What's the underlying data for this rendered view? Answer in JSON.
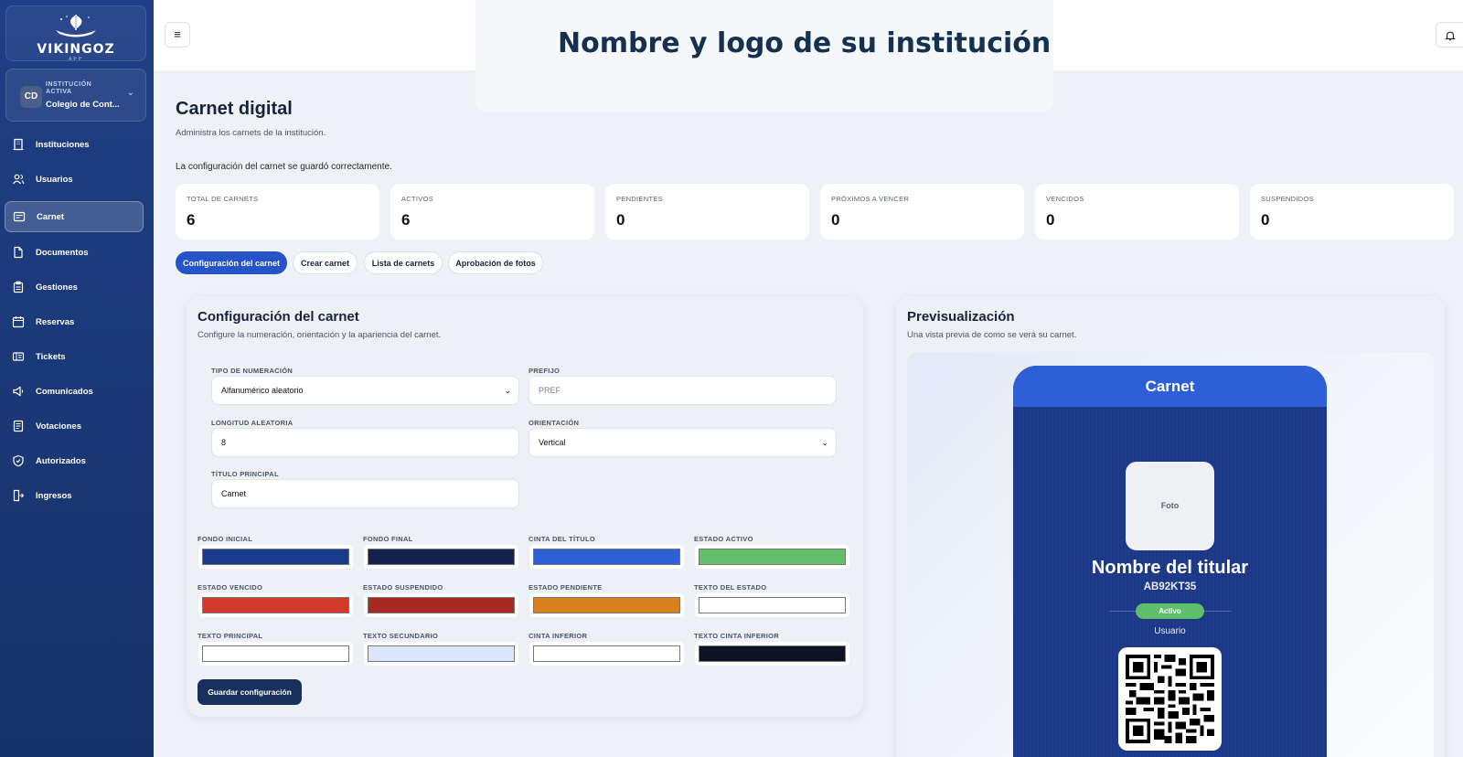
{
  "brand": {
    "name": "VIKINGOZ",
    "sub": "APP"
  },
  "institution": {
    "initials": "CD",
    "label": "INSTITUCIÓN ACTIVA",
    "name": "Colegio de Cont..."
  },
  "nav": [
    {
      "label": "Instituciones",
      "icon": "building-icon"
    },
    {
      "label": "Usuarios",
      "icon": "users-icon"
    },
    {
      "label": "Carnet",
      "icon": "id-card-icon",
      "active": true
    },
    {
      "label": "Documentos",
      "icon": "document-icon"
    },
    {
      "label": "Gestiones",
      "icon": "clipboard-icon"
    },
    {
      "label": "Reservas",
      "icon": "calendar-icon"
    },
    {
      "label": "Tickets",
      "icon": "ticket-icon"
    },
    {
      "label": "Comunicados",
      "icon": "megaphone-icon"
    },
    {
      "label": "Votaciones",
      "icon": "ballot-icon"
    },
    {
      "label": "Autorizados",
      "icon": "shield-icon"
    },
    {
      "label": "Ingresos",
      "icon": "login-icon"
    }
  ],
  "header": {
    "banner": "Nombre y logo de su institución"
  },
  "page": {
    "title": "Carnet digital",
    "subtitle": "Administra los carnets de la institución.",
    "notice": "La configuración del carnet se guardó correctamente."
  },
  "stats": [
    {
      "label": "TOTAL DE CARNETS",
      "value": "6"
    },
    {
      "label": "ACTIVOS",
      "value": "6"
    },
    {
      "label": "PENDIENTES",
      "value": "0"
    },
    {
      "label": "PRÓXIMOS A VENCER",
      "value": "0"
    },
    {
      "label": "VENCIDOS",
      "value": "0"
    },
    {
      "label": "SUSPENDIDOS",
      "value": "0"
    }
  ],
  "tabs": [
    {
      "label": "Configuración del carnet",
      "active": true
    },
    {
      "label": "Crear carnet"
    },
    {
      "label": "Lista de carnets"
    },
    {
      "label": "Aprobación de fotos"
    }
  ],
  "config": {
    "title": "Configuración del carnet",
    "subtitle": "Configure la numeración, orientación y la apariencia del carnet.",
    "numbering_label": "TIPO DE NUMERACIÓN",
    "numbering_value": "Alfanumérico aleatorio",
    "prefix_label": "PREFIJO",
    "prefix_placeholder": "PREF",
    "length_label": "LONGITUD ALEATORIA",
    "length_value": "8",
    "orientation_label": "ORIENTACIÓN",
    "orientation_value": "Vertical",
    "main_title_label": "TÍTULO PRINCIPAL",
    "main_title_value": "Carnet",
    "colors": [
      {
        "label": "FONDO INICIAL",
        "color": "#1a3a8c"
      },
      {
        "label": "FONDO FINAL",
        "color": "#13234d"
      },
      {
        "label": "CINTA DEL TÍTULO",
        "color": "#2d5fd6"
      },
      {
        "label": "ESTADO ACTIVO",
        "color": "#63c06a"
      },
      {
        "label": "ESTADO VENCIDO",
        "color": "#d23b2b"
      },
      {
        "label": "ESTADO SUSPENDIDO",
        "color": "#a8291f"
      },
      {
        "label": "ESTADO PENDIENTE",
        "color": "#d97f20"
      },
      {
        "label": "TEXTO DEL ESTADO",
        "color": "#ffffff"
      },
      {
        "label": "TEXTO PRINCIPAL",
        "color": "#ffffff"
      },
      {
        "label": "TEXTO SECUNDARIO",
        "color": "#dce6fa"
      },
      {
        "label": "CINTA INFERIOR",
        "color": "#ffffff"
      },
      {
        "label": "TEXTO CINTA INFERIOR",
        "color": "#0c1424"
      }
    ],
    "save_label": "Guardar configuración"
  },
  "preview": {
    "title": "Previsualización",
    "subtitle": "Una vista previa de como se verá su carnet.",
    "card_title": "Carnet",
    "photo": "Foto",
    "holder": "Nombre del titular",
    "code": "AB92KT35",
    "status": "Activo",
    "role": "Usuario"
  }
}
